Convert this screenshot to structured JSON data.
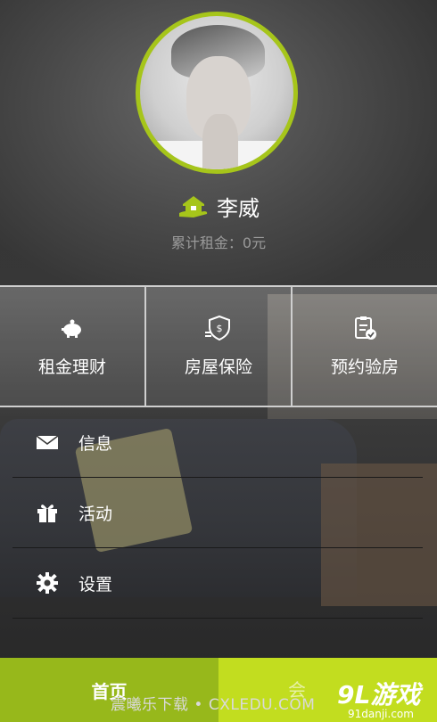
{
  "profile": {
    "name": "李威",
    "rent_total": "累计租金：0元"
  },
  "services": [
    {
      "label": "租金理财",
      "icon": "piggy-bank-icon"
    },
    {
      "label": "房屋保险",
      "icon": "shield-money-icon"
    },
    {
      "label": "预约验房",
      "icon": "clipboard-check-icon"
    }
  ],
  "menu": [
    {
      "label": "信息",
      "icon": "mail-icon"
    },
    {
      "label": "活动",
      "icon": "gift-icon"
    },
    {
      "label": "设置",
      "icon": "gear-icon"
    }
  ],
  "tabs": {
    "home": "首页",
    "other": "会"
  },
  "watermark": "震曦乐下载 • CXLEDU.COM",
  "brand": {
    "logo": "9L游戏",
    "sub": "91danji.com"
  },
  "colors": {
    "accent": "#a6c51a",
    "tab_home": "#97b81b",
    "tab_other": "#c2dd1f"
  }
}
